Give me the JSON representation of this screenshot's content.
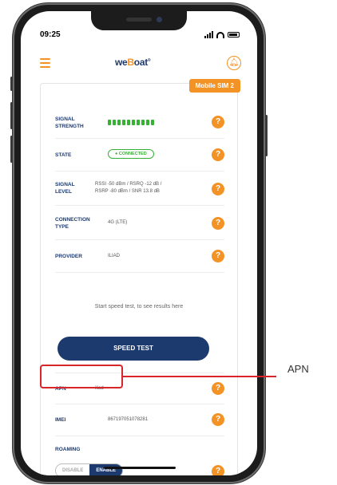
{
  "status": {
    "time": "09:25"
  },
  "header": {
    "logo_prefix": "we",
    "logo_mark": "B",
    "logo_suffix": "oat",
    "logo_sup": "®"
  },
  "sim_badge": "Mobile SIM 2",
  "rows": {
    "signal_strength": {
      "label_1": "SIGNAL",
      "label_2": "STRENGTH",
      "bars": 10
    },
    "state": {
      "label": "STATE",
      "value": "CONNECTED"
    },
    "signal_level": {
      "label_1": "SIGNAL",
      "label_2": "LEVEL",
      "value_1": "RSSI -50 dBm / RSRQ -12 dB /",
      "value_2": "RSRP -80 dBm / SNR 13.8 dB"
    },
    "connection_type": {
      "label_1": "CONNECTION",
      "label_2": "TYPE",
      "value": "4G (LTE)"
    },
    "provider": {
      "label": "PROVIDER",
      "value": "ILIAD"
    },
    "apn": {
      "label": "APN",
      "value": "iliad"
    },
    "imei": {
      "label": "IMEI",
      "value": "867197051078281"
    },
    "roaming": {
      "label": "ROAMING",
      "disable": "DISABLE",
      "enable": "ENABLE"
    }
  },
  "speed_hint": "Start speed test, to see results here",
  "speed_button": "SPEED TEST",
  "help_glyph": "?",
  "annotation": {
    "label": "APN",
    "color": "#d9252a"
  },
  "colors": {
    "accent": "#f39325",
    "navy": "#1d3a6e",
    "green": "#35b233"
  }
}
